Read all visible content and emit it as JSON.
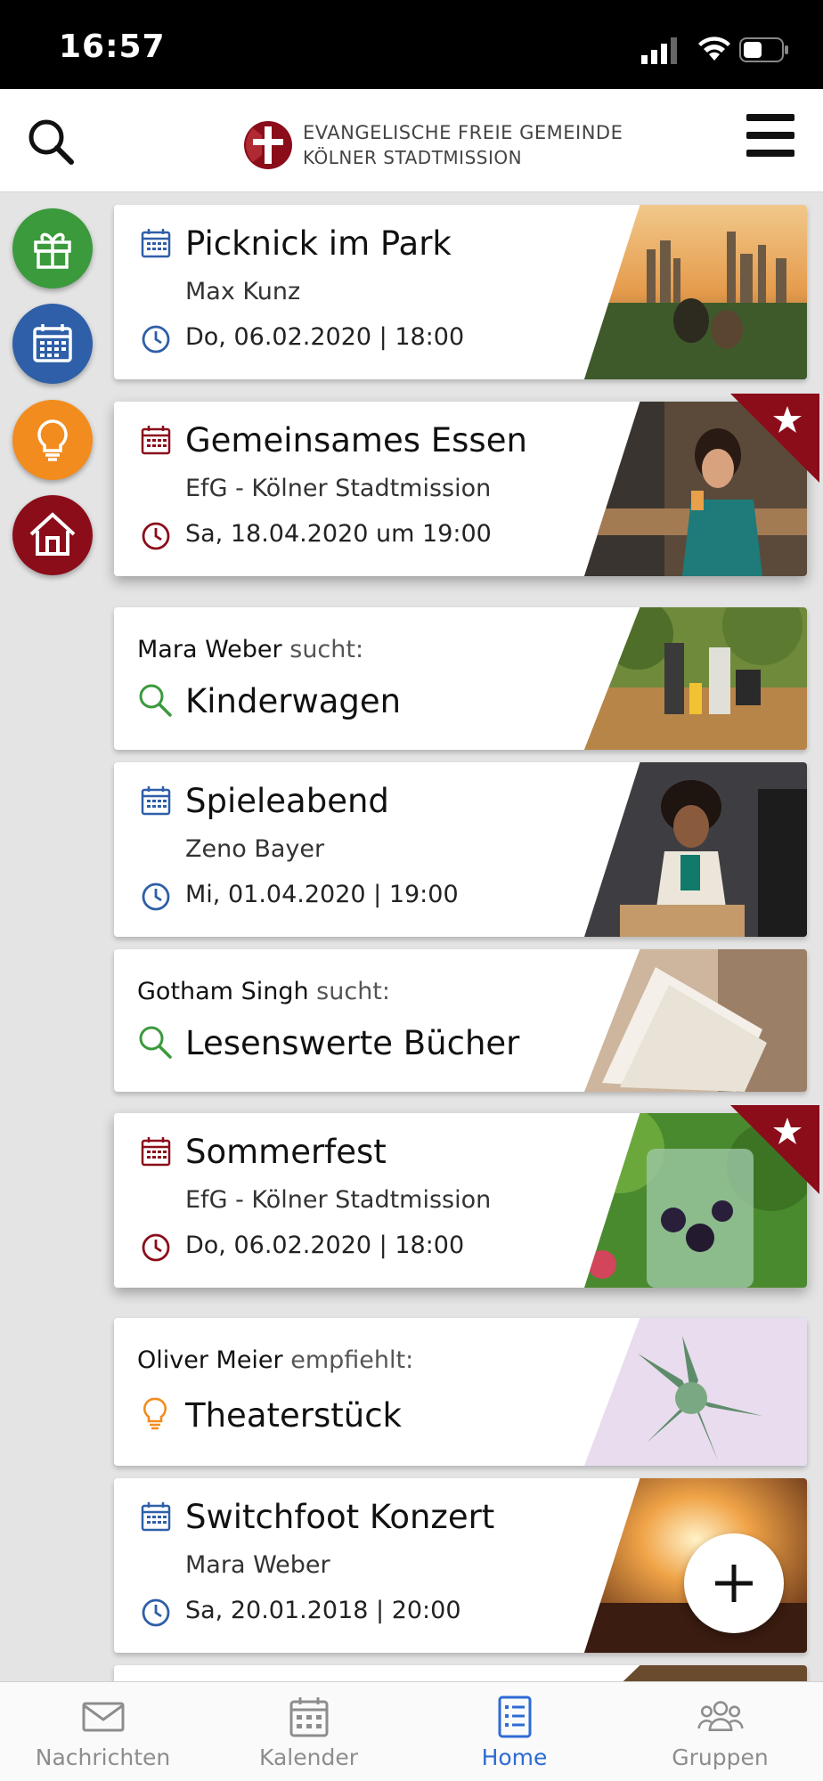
{
  "status_bar": {
    "time": "16:57"
  },
  "header": {
    "logo_line1": "EVANGELISCHE FREIE GEMEINDE",
    "logo_line2": "KÖLNER STADTMISSION"
  },
  "colors": {
    "accent_blue": "#2e5fa8",
    "accent_red": "#8b0d1a",
    "green": "#3a9a3c",
    "orange": "#f28c1e",
    "tab_active": "#2e6bd5"
  },
  "side_buttons": [
    {
      "icon": "gift-icon",
      "color": "#3a9a3c"
    },
    {
      "icon": "calendar-icon",
      "color": "#2e5fa8"
    },
    {
      "icon": "lightbulb-icon",
      "color": "#f28c1e"
    },
    {
      "icon": "home-icon",
      "color": "#8b0d1a"
    }
  ],
  "feed": [
    {
      "type": "event",
      "title": "Picknick im Park",
      "organizer": "Max Kunz",
      "date": "Do, 06.02.2020 | 18:00",
      "featured": false
    },
    {
      "type": "event",
      "title": "Gemeinsames Essen",
      "organizer": "EfG - Kölner Stadtmission",
      "date": "Sa, 18.04.2020 um 19:00",
      "featured": true
    },
    {
      "type": "request",
      "person": "Mara Weber",
      "verb": "sucht:",
      "title": "Kinderwagen"
    },
    {
      "type": "event",
      "title": "Spieleabend",
      "organizer": "Zeno Bayer",
      "date": "Mi, 01.04.2020 | 19:00",
      "featured": false
    },
    {
      "type": "request",
      "person": "Gotham Singh",
      "verb": "sucht:",
      "title": "Lesenswerte Bücher"
    },
    {
      "type": "event",
      "title": "Sommerfest",
      "organizer": "EfG - Kölner Stadtmission",
      "date": "Do, 06.02.2020 | 18:00",
      "featured": true
    },
    {
      "type": "recommendation",
      "person": "Oliver Meier",
      "verb": "empfiehlt:",
      "title": "Theaterstück"
    },
    {
      "type": "event",
      "title": "Switchfoot Konzert",
      "organizer": "Mara Weber",
      "date": "Sa, 20.01.2018 | 20:00",
      "featured": false
    }
  ],
  "tabs": [
    {
      "label": "Nachrichten",
      "icon": "mail-icon",
      "active": false
    },
    {
      "label": "Kalender",
      "icon": "calendar-icon",
      "active": false
    },
    {
      "label": "Home",
      "icon": "list-icon",
      "active": true
    },
    {
      "label": "Gruppen",
      "icon": "group-icon",
      "active": false
    }
  ]
}
